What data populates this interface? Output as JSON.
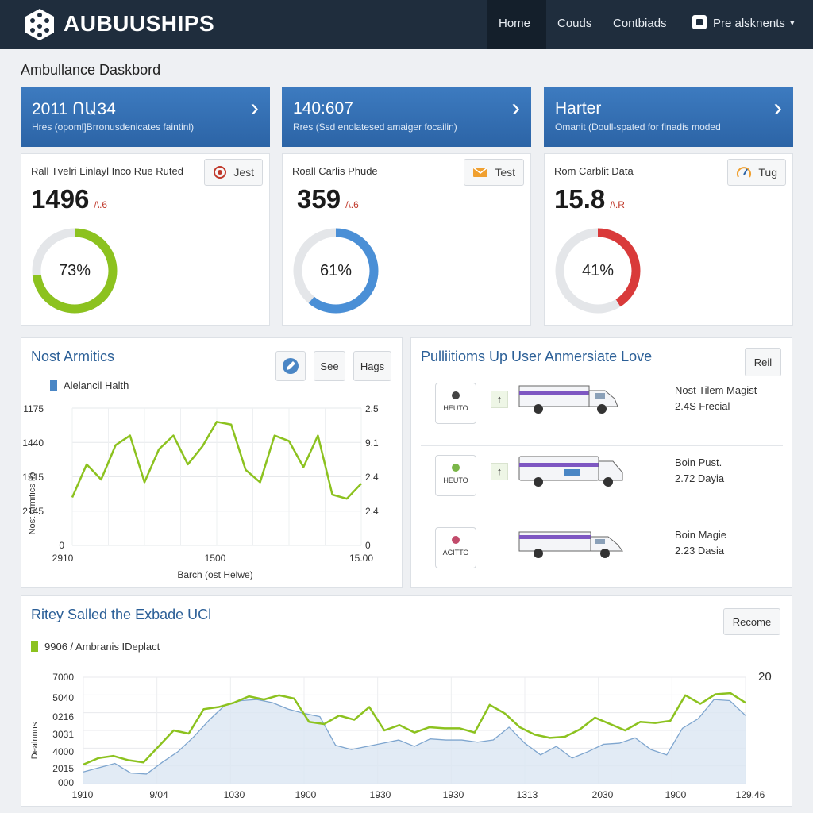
{
  "app": {
    "brand": "AUBUUSHIPS",
    "page_title": "Ambullance Daskbord"
  },
  "nav": {
    "items": [
      {
        "label": "Home",
        "active": true
      },
      {
        "label": "Couds",
        "active": false
      },
      {
        "label": "Contbiads",
        "active": false
      },
      {
        "label": "Pre alsknents",
        "active": false,
        "has_dropdown": true
      }
    ]
  },
  "cards": [
    {
      "header_title": "2011 ՈԱ34",
      "header_sub": "Hres (opoml]Brronusdenicates faintinl)",
      "stat_label": "Rall Tvelri Linlayl Inco Rue Ruted",
      "button_label": "Jest",
      "button_icon": "record-icon",
      "value": "1496",
      "value_suffix": "/\\.6",
      "percent_label": "73%",
      "percent": 0.73,
      "color": "#8cc21f"
    },
    {
      "header_title": "140:607",
      "header_sub": "Rres (Ssd enolatesed amaiger focailin)",
      "stat_label": "Roall Carlis Phude",
      "button_label": "Test",
      "button_icon": "mail-icon",
      "value": "359",
      "value_suffix": "/\\.6",
      "percent_label": "61%",
      "percent": 0.61,
      "color": "#4a8fd6"
    },
    {
      "header_title": "Harter",
      "header_sub": "Omanit (Doull-spated for finadis moded",
      "stat_label": "Rom Carblit Data",
      "button_label": "Tug",
      "button_icon": "gauge-icon",
      "value": "15.8",
      "value_suffix": "/\\.R",
      "percent_label": "41%",
      "percent": 0.41,
      "color": "#d93a3a"
    }
  ],
  "analytics": {
    "title": "Nost Armitics",
    "buttons": [
      "See",
      "Hags"
    ],
    "legend": "Alelancil Halth",
    "legend_color": "#4a86c5",
    "y_left_ticks": [
      "1175",
      "1440",
      "1515",
      "2145",
      "0"
    ],
    "y_right_ticks": [
      "2.5",
      "9.1",
      "2.4",
      "2.4",
      "0"
    ],
    "y_left_title": "Nost Armitics Ilo",
    "x_ticks": [
      "2910",
      "1500",
      "15.00"
    ],
    "x_title": "Barch (ost Helwe)",
    "line_color": "#8cc21f"
  },
  "fleet": {
    "title": "Pulliitioms Up User Anmersiate Love",
    "button": "Reil",
    "rows": [
      {
        "tag": "HEUTO",
        "tag_color": "#444444",
        "arrow": "↑",
        "name": "Nost Tilem Magist",
        "detail": "2.4S Frecial"
      },
      {
        "tag": "HEUTO",
        "tag_color": "#7ab648",
        "arrow": "↑",
        "name": "Boin Pust.",
        "detail": "2.72 Dayia"
      },
      {
        "tag": "ACITTO",
        "tag_color": "#c24b6b",
        "arrow": "",
        "name": "Boin Magie",
        "detail": "2.23 Dasia"
      }
    ]
  },
  "bottom_chart": {
    "title": "Ritey Salled the Exbade UCl",
    "button": "Recome",
    "legend": "9906 / Ambranis IDeplact",
    "legend_color": "#8cc21f",
    "y_ticks": [
      "7000",
      "5040",
      "0216",
      "3031",
      "4000",
      "2015",
      "000"
    ],
    "y_title": "Dealnnns",
    "y_right_label": "20",
    "x_ticks": [
      "1910",
      "9/04",
      "1030",
      "1900",
      "1930",
      "1930",
      "1313",
      "2030",
      "1900",
      "129.46"
    ]
  },
  "chart_data": [
    {
      "type": "line",
      "title": "Nost Armitics",
      "xlabel": "Barch (ost Helwe)",
      "ylabel": "Nost Armitics Ilo",
      "y_tick_labels": [
        "1175",
        "1440",
        "1515",
        "2145",
        "0"
      ],
      "x_tick_labels": [
        "2910",
        "1500",
        "15.00"
      ],
      "ylim": [
        0,
        100
      ],
      "series": [
        {
          "name": "Alelancil Halth",
          "values": [
            35,
            59,
            48,
            73,
            80,
            46,
            70,
            80,
            59,
            72,
            90,
            88,
            55,
            46,
            80,
            76,
            57,
            80,
            37,
            34,
            45
          ]
        }
      ]
    },
    {
      "type": "area",
      "title": "Ritey Salled the Exbade UCl",
      "ylabel": "Dealnnns",
      "y_tick_labels": [
        "7000",
        "5040",
        "0216",
        "3031",
        "4000",
        "2015",
        "000"
      ],
      "x_tick_labels": [
        "1910",
        "9/04",
        "1030",
        "1900",
        "1930",
        "1930",
        "1313",
        "2030",
        "1900",
        "129.46"
      ],
      "ylim": [
        0,
        100
      ],
      "series": [
        {
          "name": "9906 / Ambranis IDeplact",
          "values": [
            18,
            24,
            26,
            22,
            20,
            35,
            50,
            47,
            70,
            72,
            76,
            82,
            79,
            83,
            80,
            58,
            56,
            64,
            60,
            72,
            50,
            55,
            48,
            53,
            52,
            52,
            48,
            74,
            66,
            53,
            46,
            43,
            44,
            51,
            62,
            56,
            50,
            58,
            57,
            59,
            83,
            75,
            84,
            85,
            76
          ]
        },
        {
          "name": "",
          "values": [
            11,
            15,
            19,
            10,
            9,
            20,
            30,
            44,
            60,
            74,
            78,
            79,
            76,
            70,
            66,
            63,
            36,
            32,
            35,
            38,
            41,
            35,
            42,
            41,
            41,
            39,
            41,
            53,
            38,
            27,
            35,
            24,
            30,
            37,
            38,
            43,
            32,
            27,
            52,
            61,
            79,
            78,
            64
          ]
        }
      ]
    }
  ]
}
